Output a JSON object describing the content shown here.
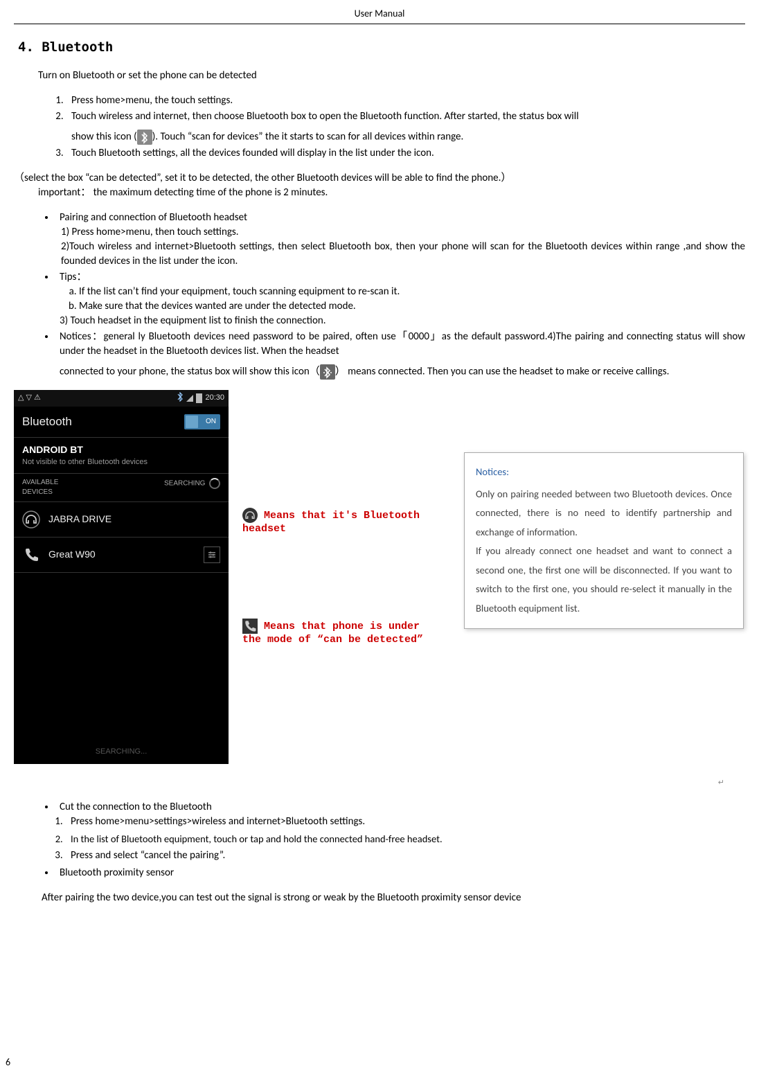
{
  "header": {
    "title": "User    Manual"
  },
  "page_number": "6",
  "section": {
    "heading": "4. Bluetooth"
  },
  "intro_line": "Turn on Bluetooth or set the phone can be detected",
  "steps_main": {
    "s1": "Press home>menu, the touch settings.",
    "s2a": "Touch wireless and internet, then choose Bluetooth box to open the Bluetooth function. After started, the status box will",
    "s2b_pre": "show this icon (",
    "s2b_post": "). Touch   “scan for devices”  the it starts to scan for all devices within range.",
    "s3": "Touch Bluetooth settings, all the devices founded will display in the list under the icon."
  },
  "select_line": "（select the box “can be detected”, set it to be detected, the other Bluetooth devices will be able to find the phone.）",
  "important_line": "important： the maximum detecting time of the phone is 2 minutes.",
  "pairing": {
    "title": "Pairing and connection of Bluetooth headset",
    "p1": "1) Press home>menu, then touch settings.",
    "p2": "2)Touch wireless and internet>Bluetooth settings, then select Bluetooth box, then your phone will scan for the Bluetooth devices within range ,and show the founded devices in the list under the icon."
  },
  "tips": {
    "title": "Tips：",
    "a": "If the list can’t find your equipment, touch scanning equipment to re-scan it.",
    "b": "Make sure that the devices wanted are under the detected mode.",
    "p3": "3) Touch headset in the equipment list to finish the connection."
  },
  "notices_bullet": {
    "pre": "Notices：general ly Bluetooth devices need password to be paired, often use「0000」as the default password.4)The pairing and connecting status will show under the headset in the Bluetooth devices list. When the headset",
    "mid_pre": "connected to your phone, the status box will show this icon（",
    "mid_post": "） means connected. Then you can use the headset to make or receive callings."
  },
  "phone": {
    "status": {
      "icons": "△ ▽ ⚠",
      "bt": "฿",
      "sig": "█",
      "batt": "▮",
      "time": "20:30"
    },
    "title": "Bluetooth",
    "toggle": "ON",
    "own_name": "ANDROID BT",
    "own_sub": "Not visible to other Bluetooth devices",
    "sect_left": "AVAILABLE\nDEVICES",
    "sect_right": "SEARCHING",
    "dev1": "JABRA DRIVE",
    "dev2": "Great W90",
    "footer": "SEARCHING..."
  },
  "annotations": {
    "a1": "Means that it's Bluetooth headset",
    "a2": "Means that phone is under the mode of “can be detected”"
  },
  "notices_box": {
    "title": "Notices:",
    "body": "Only on pairing needed between two Bluetooth devices. Once connected, there is no need to identify partnership and exchange of information.\nIf you already connect one headset and want to connect a second one, the first one will be disconnected. If you want to switch to the first one, you should re-select it manually in the Bluetooth equipment list."
  },
  "cut": {
    "title": "Cut the connection to the Bluetooth",
    "c1": "Press home>menu>settings>wireless and internet>Bluetooth settings.",
    "c2": "In the list of Bluetooth equipment, touch or tap and hold the connected hand-free headset.",
    "c3": "Press and select “cancel the pairing”."
  },
  "prox": {
    "title": "Bluetooth proximity sensor",
    "body": "After pairing the two device,you can test out the signal is strong or weak by the Bluetooth proximity sensor device"
  }
}
